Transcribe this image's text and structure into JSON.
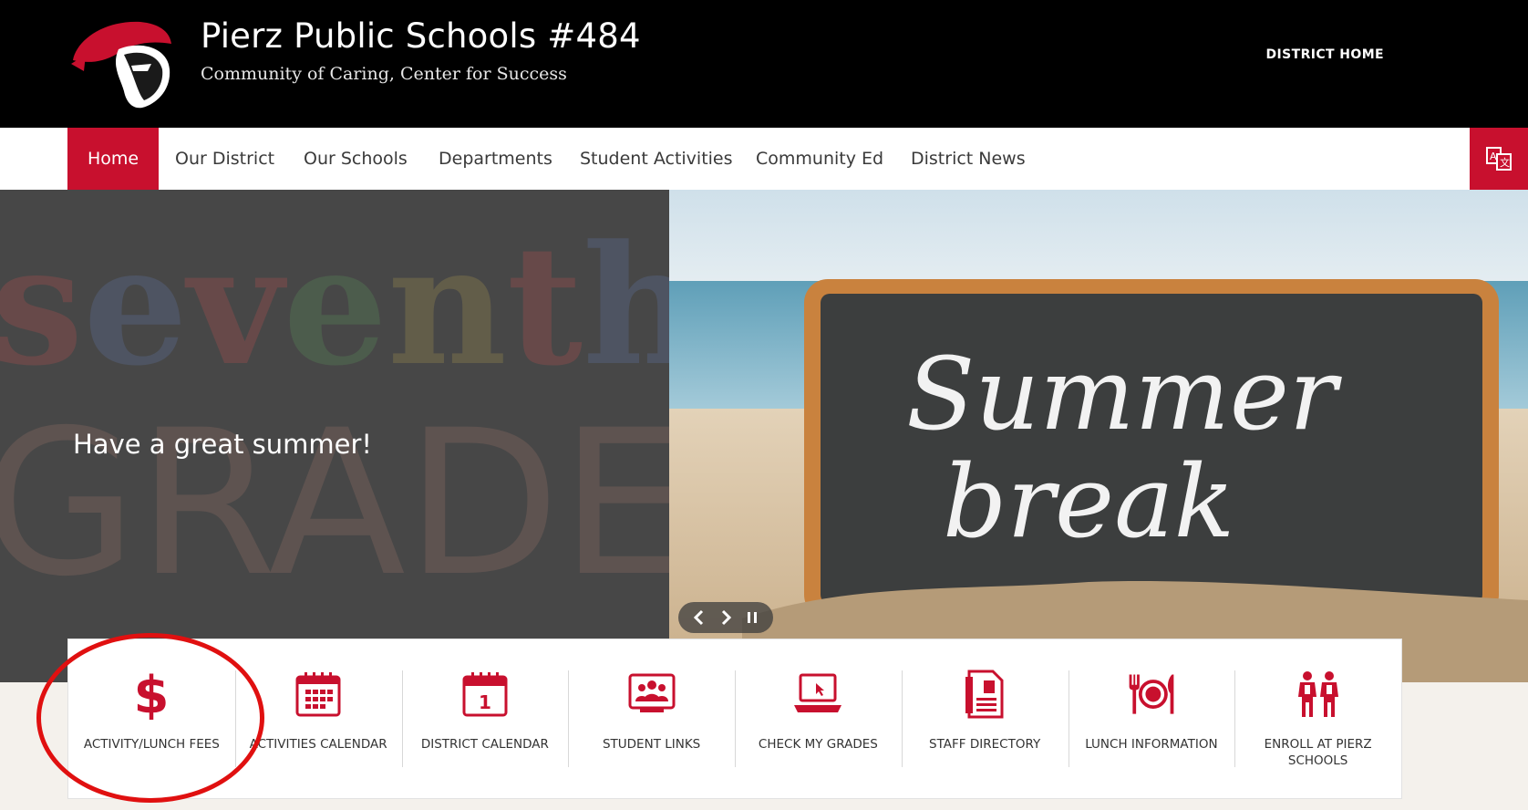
{
  "header": {
    "title": "Pierz Public Schools #484",
    "tagline": "Community of Caring, Center for Success",
    "district_home": "DISTRICT HOME"
  },
  "nav": {
    "items": [
      {
        "label": "Home",
        "active": true
      },
      {
        "label": "Our District"
      },
      {
        "label": "Our Schools"
      },
      {
        "label": "Departments"
      },
      {
        "label": "Student Activities"
      },
      {
        "label": "Community Ed"
      },
      {
        "label": "District News"
      }
    ],
    "translate_icon": "translate-icon"
  },
  "hero": {
    "caption": "Have a great summer!",
    "left_image_text": [
      "seventh",
      "GRADE"
    ],
    "right_image_text": [
      "Summer",
      "break"
    ]
  },
  "quicklinks": [
    {
      "label": "ACTIVITY/LUNCH FEES",
      "icon": "dollar-icon"
    },
    {
      "label": "ACTIVITIES CALENDAR",
      "icon": "calendar-grid-icon"
    },
    {
      "label": "DISTRICT CALENDAR",
      "icon": "calendar-day-icon",
      "day": "1"
    },
    {
      "label": "STUDENT LINKS",
      "icon": "group-icon"
    },
    {
      "label": "CHECK MY GRADES",
      "icon": "laptop-icon"
    },
    {
      "label": "STAFF DIRECTORY",
      "icon": "directory-icon"
    },
    {
      "label": "LUNCH INFORMATION",
      "icon": "plate-icon"
    },
    {
      "label": "ENROLL AT PIERZ SCHOOLS",
      "icon": "students-icon"
    }
  ],
  "colors": {
    "brand_red": "#c8102e",
    "header_bg": "#000000"
  }
}
